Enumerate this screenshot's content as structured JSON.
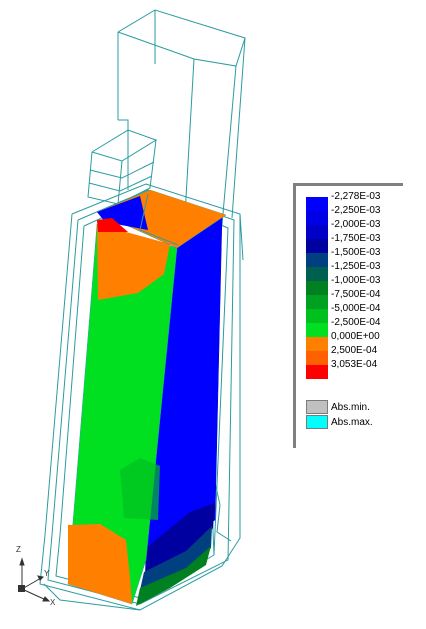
{
  "legend": {
    "levels": [
      {
        "label": "-2,278E-03",
        "color": "#0000ff"
      },
      {
        "label": "-2,250E-03",
        "color": "#0000e6"
      },
      {
        "label": "-2,000E-03",
        "color": "#0000c8"
      },
      {
        "label": "-1,750E-03",
        "color": "#0000a0"
      },
      {
        "label": "-1,500E-03",
        "color": "#004080"
      },
      {
        "label": "-1,250E-03",
        "color": "#006050"
      },
      {
        "label": "-1,000E-03",
        "color": "#008020"
      },
      {
        "label": "-7,500E-04",
        "color": "#00a020"
      },
      {
        "label": "-5,000E-04",
        "color": "#00c020"
      },
      {
        "label": "-2,500E-04",
        "color": "#00e020"
      },
      {
        "label": "0,000E+00",
        "color": "#ff8000"
      },
      {
        "label": "2,500E-04",
        "color": "#ff6000"
      },
      {
        "label": "3,053E-04",
        "color": "#ff0000"
      }
    ],
    "abs_min": {
      "label": "Abs.min.",
      "color": "#c0c0c0"
    },
    "abs_max": {
      "label": "Abs.max.",
      "color": "#00ffff"
    }
  },
  "axes": {
    "x_label": "X",
    "y_label": "Y",
    "z_label": "Z"
  },
  "colors": {
    "wire": "#2a9ca0",
    "blue": "#0000ff",
    "green": "#00e020",
    "orange": "#ff8000",
    "red": "#ff0000"
  }
}
